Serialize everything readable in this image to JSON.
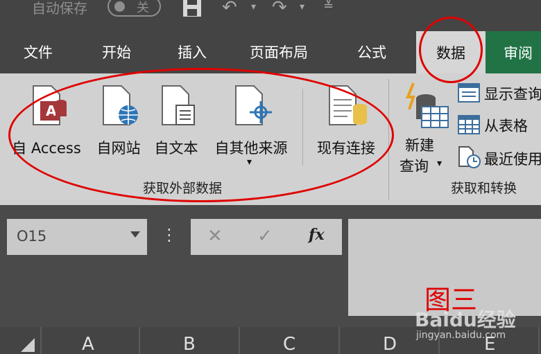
{
  "titlebar": {
    "autosave_label": "自动保存",
    "toggle_state": "关"
  },
  "tabs": [
    {
      "label": "文件"
    },
    {
      "label": "开始"
    },
    {
      "label": "插入"
    },
    {
      "label": "页面布局"
    },
    {
      "label": "公式"
    },
    {
      "label": "数据",
      "active": true
    },
    {
      "label": "审阅"
    }
  ],
  "ribbon": {
    "group_external": {
      "title": "获取外部数据",
      "buttons": [
        {
          "label": "自 Access",
          "icon": "access-icon"
        },
        {
          "label": "自网站",
          "icon": "web-icon"
        },
        {
          "label": "自文本",
          "icon": "text-file-icon"
        },
        {
          "label": "自其他来源",
          "icon": "other-sources-icon"
        },
        {
          "label": "现有连接",
          "icon": "existing-connections-icon"
        }
      ]
    },
    "group_transform": {
      "title": "获取和转换",
      "new_query_line1": "新建",
      "new_query_line2": "查询",
      "items": [
        {
          "label": "显示查询",
          "icon": "show-queries-icon"
        },
        {
          "label": "从表格",
          "icon": "from-table-icon"
        },
        {
          "label": "最近使用",
          "icon": "recent-sources-icon"
        }
      ]
    }
  },
  "formula_bar": {
    "name_box": "O15",
    "fx_label": "fx"
  },
  "columns": [
    "A",
    "B",
    "C",
    "D",
    "E"
  ],
  "annotation": {
    "figure_label": "图三",
    "watermark": "Baidu经验",
    "watermark_url": "jingyan.baidu.com",
    "color": "#e00000"
  }
}
